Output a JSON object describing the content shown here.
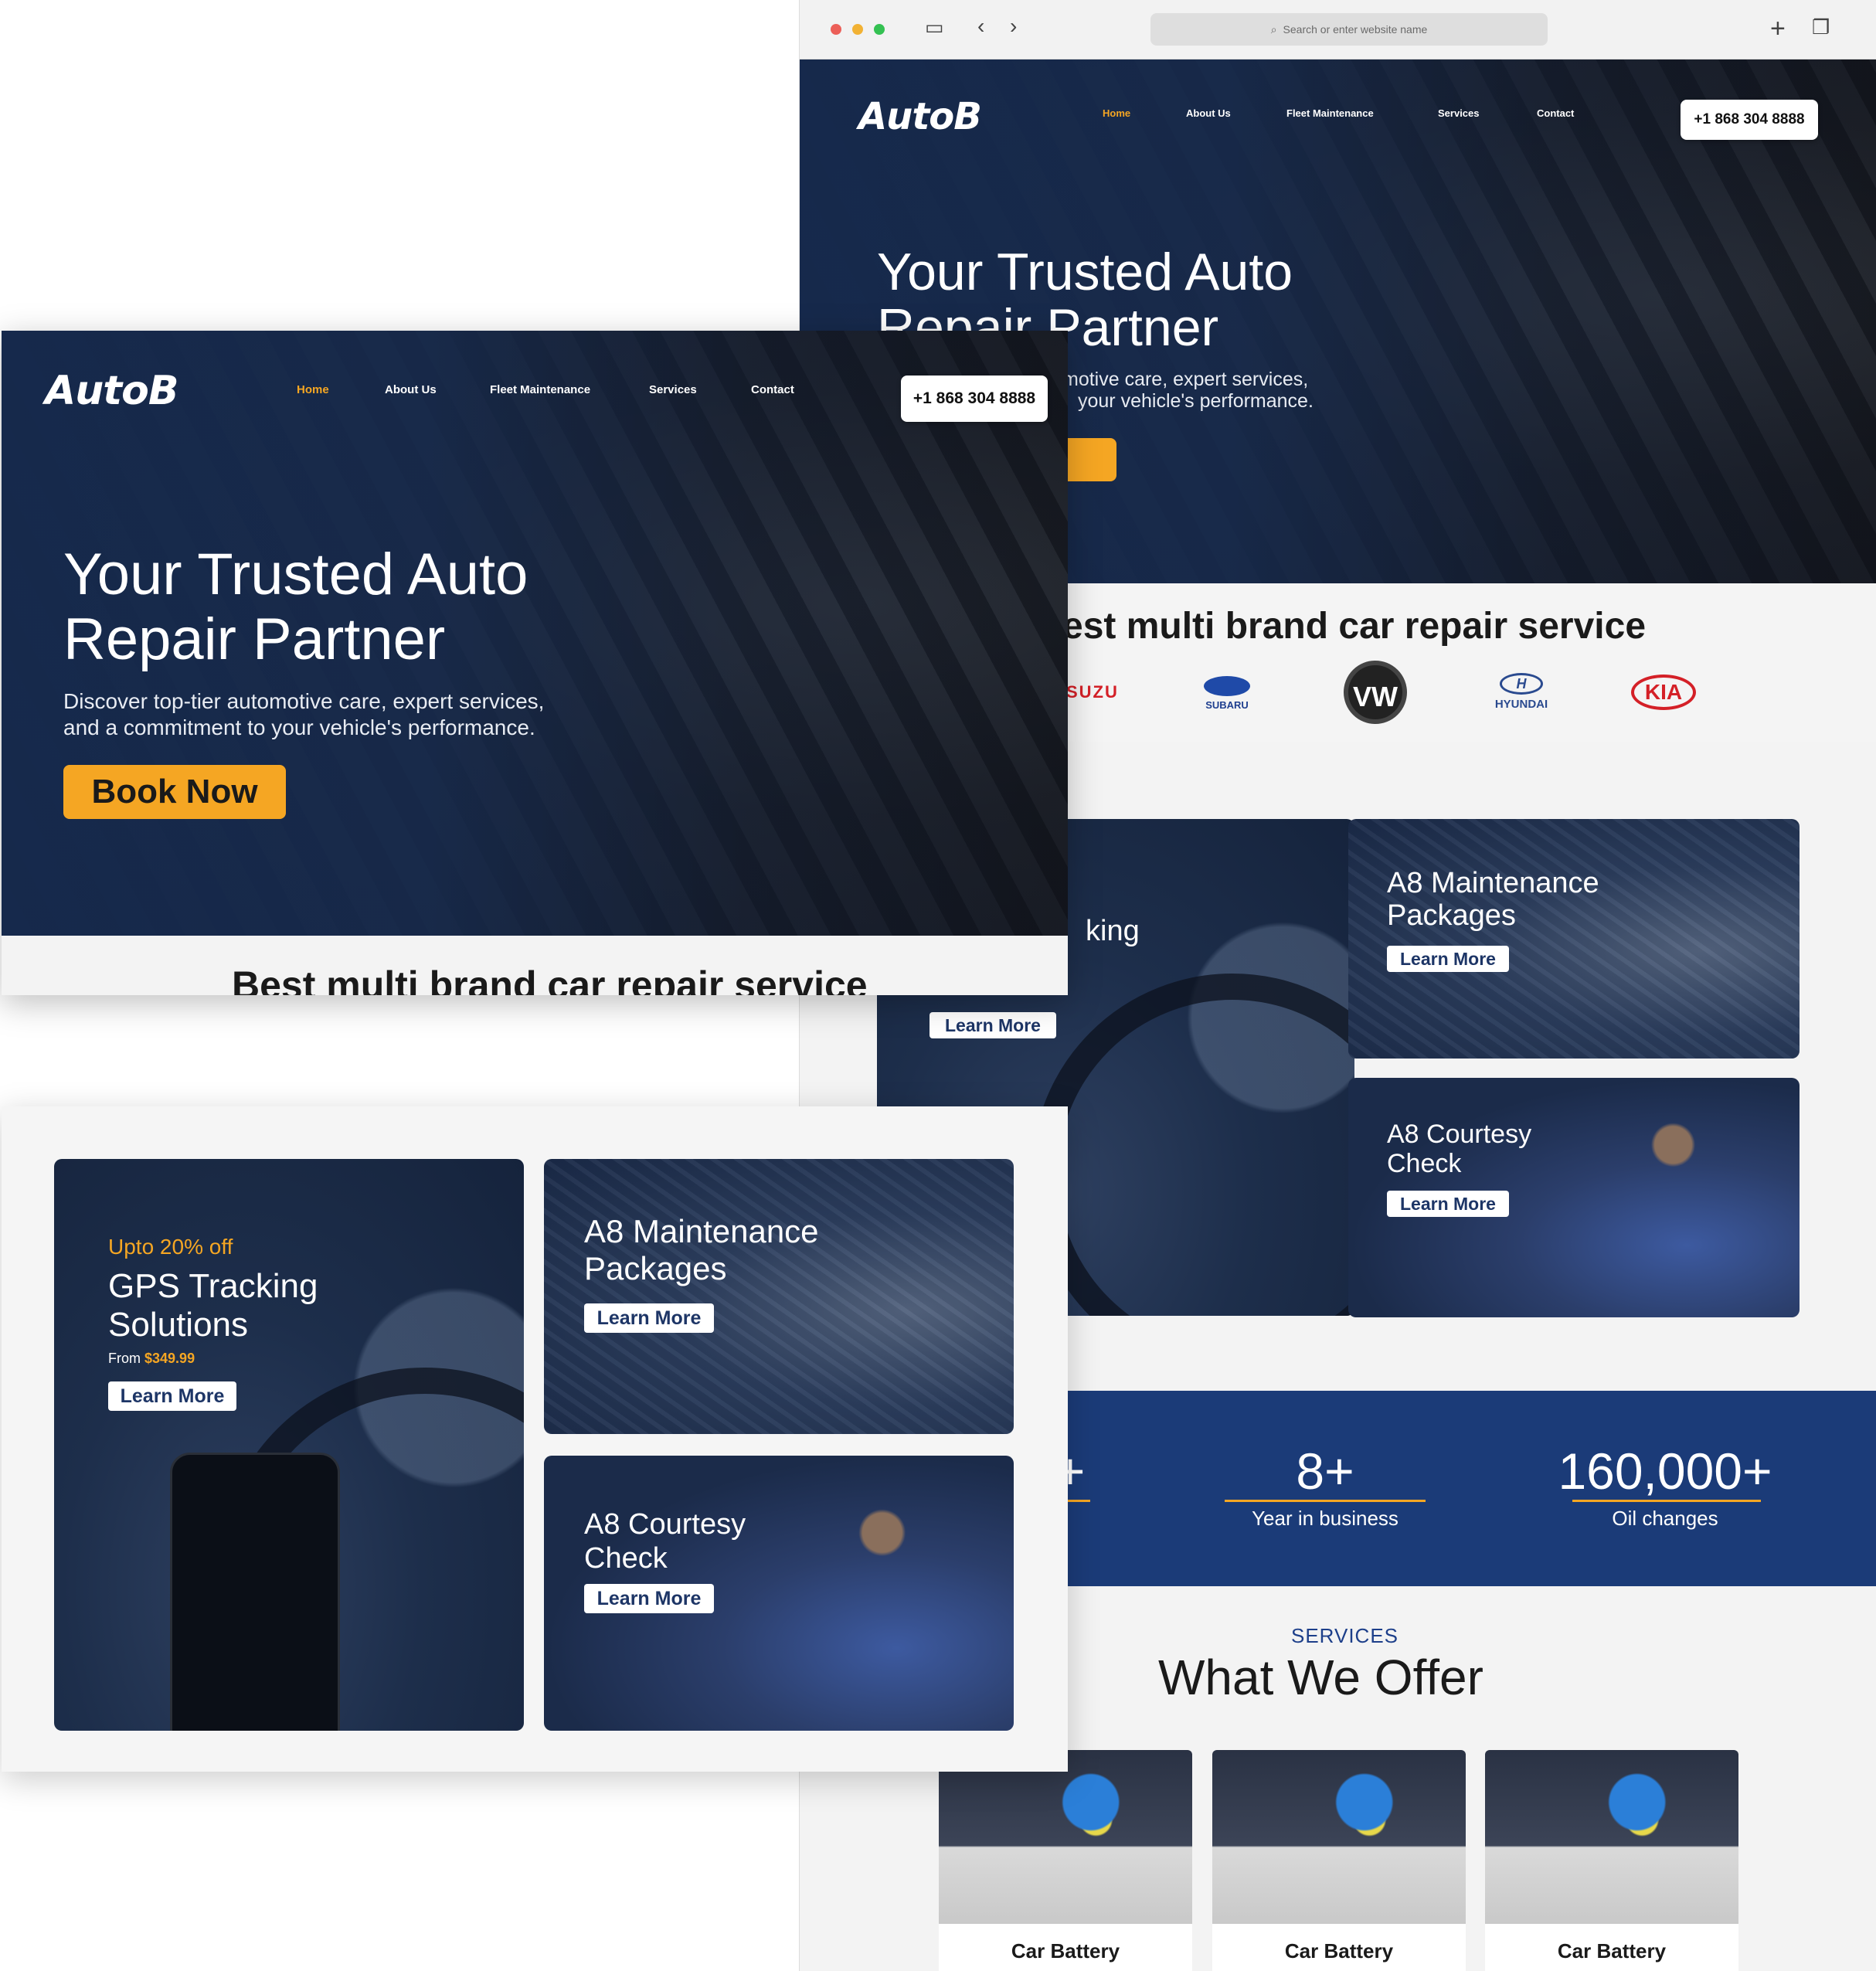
{
  "browser": {
    "url_placeholder": "Search or enter website name"
  },
  "site": {
    "logo": "AutoB",
    "nav": [
      "Home",
      "About Us",
      "Fleet Maintenance",
      "Services",
      "Contact"
    ],
    "phone": "+1 868 304 8888"
  },
  "hero": {
    "title_line1": "Your Trusted Auto",
    "title_line2": "Repair Partner",
    "sub_line1": "Discover top-tier automotive care, expert services,",
    "sub_line2": "and a commitment to your vehicle's performance.",
    "book_label": "Book Now"
  },
  "back_hero": {
    "title_line1": "Your Trusted Auto",
    "title_line2": "Repair Partner",
    "sub_line1": "motive care, expert services,",
    "sub_line2": "your vehicle's performance."
  },
  "brands": {
    "title": "Best multi brand car repair service",
    "back_title": "est multi brand car repair service",
    "items": [
      "SUZU",
      "SUBARU",
      "VW",
      "HYUNDAI",
      "KIA"
    ]
  },
  "promo": {
    "discount": "Upto 20% off",
    "gps_title_line1": "GPS Tracking",
    "gps_title_line2": "Solutions",
    "price_prefix": "From",
    "price": "$349.99",
    "maintenance_line1": "A8 Maintenance",
    "maintenance_line2": "Packages",
    "courtesy_line1": "A8 Courtesy",
    "courtesy_line2": "Check",
    "learn_more": "Learn More",
    "back_partial_title": "king"
  },
  "stats": {
    "items": [
      {
        "value": "8+",
        "label": "Year in business"
      },
      {
        "value": "160,000+",
        "label": "Oil changes"
      }
    ],
    "partial_value": "+"
  },
  "services": {
    "kicker": "SERVICES",
    "title": "What We Offer",
    "cards": [
      "Car Battery",
      "Car Battery",
      "Car Battery"
    ]
  },
  "colors": {
    "accent": "#f5a623",
    "navy": "#1b3b78",
    "card_navy": "#1f3150"
  }
}
